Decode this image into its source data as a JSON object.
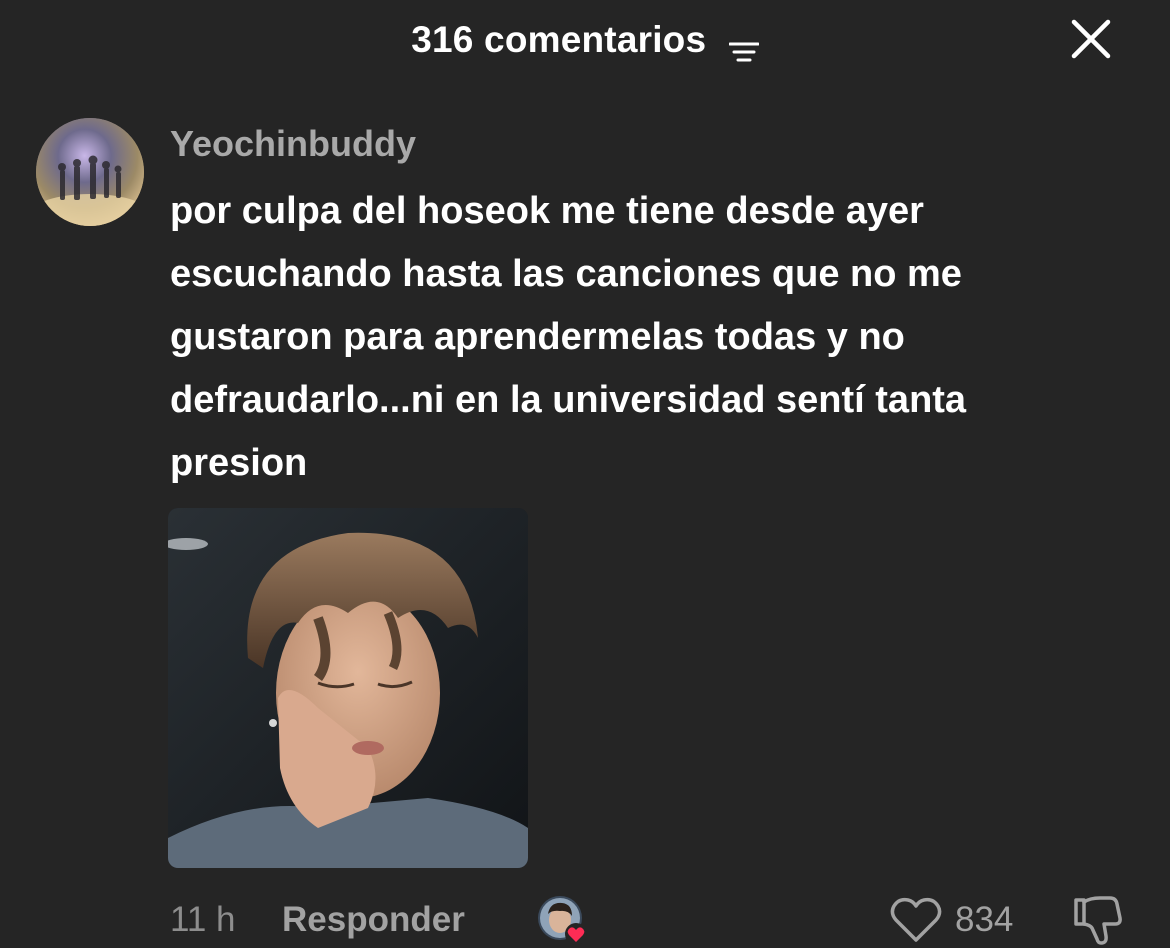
{
  "header": {
    "title": "316 comentarios",
    "filter_icon": "filter-lines-icon",
    "close_icon": "close-x-icon"
  },
  "comment": {
    "username": "Yeochinbuddy",
    "text": "por culpa del hoseok me tiene desde ayer\nescuchando hasta las canciones que no me\ngustaron para aprendermelas todas y no\ndefraudarlo...ni en la universidad sentí tanta\npresion",
    "time": "11 h",
    "reply_label": "Responder",
    "likes": "834"
  },
  "colors": {
    "background": "#252525",
    "text_primary": "#ffffff",
    "text_secondary": "#a9a9a9",
    "heart_badge": "#fe2c55"
  }
}
